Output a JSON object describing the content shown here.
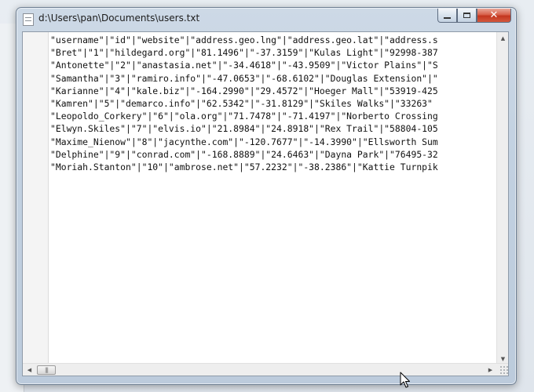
{
  "window": {
    "title": "d:\\Users\\pan\\Documents\\users.txt"
  },
  "editor": {
    "lines": [
      "\"username\"|\"id\"|\"website\"|\"address.geo.lng\"|\"address.geo.lat\"|\"address.s",
      "\"Bret\"|\"1\"|\"hildegard.org\"|\"81.1496\"|\"-37.3159\"|\"Kulas Light\"|\"92998-387",
      "\"Antonette\"|\"2\"|\"anastasia.net\"|\"-34.4618\"|\"-43.9509\"|\"Victor Plains\"|\"S",
      "\"Samantha\"|\"3\"|\"ramiro.info\"|\"-47.0653\"|\"-68.6102\"|\"Douglas Extension\"|\"",
      "\"Karianne\"|\"4\"|\"kale.biz\"|\"-164.2990\"|\"29.4572\"|\"Hoeger Mall\"|\"53919-425",
      "\"Kamren\"|\"5\"|\"demarco.info\"|\"62.5342\"|\"-31.8129\"|\"Skiles Walks\"|\"33263\"",
      "\"Leopoldo_Corkery\"|\"6\"|\"ola.org\"|\"71.7478\"|\"-71.4197\"|\"Norberto Crossing",
      "\"Elwyn.Skiles\"|\"7\"|\"elvis.io\"|\"21.8984\"|\"24.8918\"|\"Rex Trail\"|\"58804-105",
      "\"Maxime_Nienow\"|\"8\"|\"jacynthe.com\"|\"-120.7677\"|\"-14.3990\"|\"Ellsworth Sum",
      "\"Delphine\"|\"9\"|\"conrad.com\"|\"-168.8889\"|\"24.6463\"|\"Dayna Park\"|\"76495-32",
      "\"Moriah.Stanton\"|\"10\"|\"ambrose.net\"|\"57.2232\"|\"-38.2386\"|\"Kattie Turnpik"
    ]
  },
  "icons": {
    "app": "text-file-icon",
    "minimize": "minimize-icon",
    "maximize": "maximize-icon",
    "close": "close-icon",
    "cursor": "mouse-pointer-icon"
  },
  "colors": {
    "close_button": "#c3361f",
    "frame": "#c2d1e1",
    "editor_bg": "#ffffff"
  }
}
